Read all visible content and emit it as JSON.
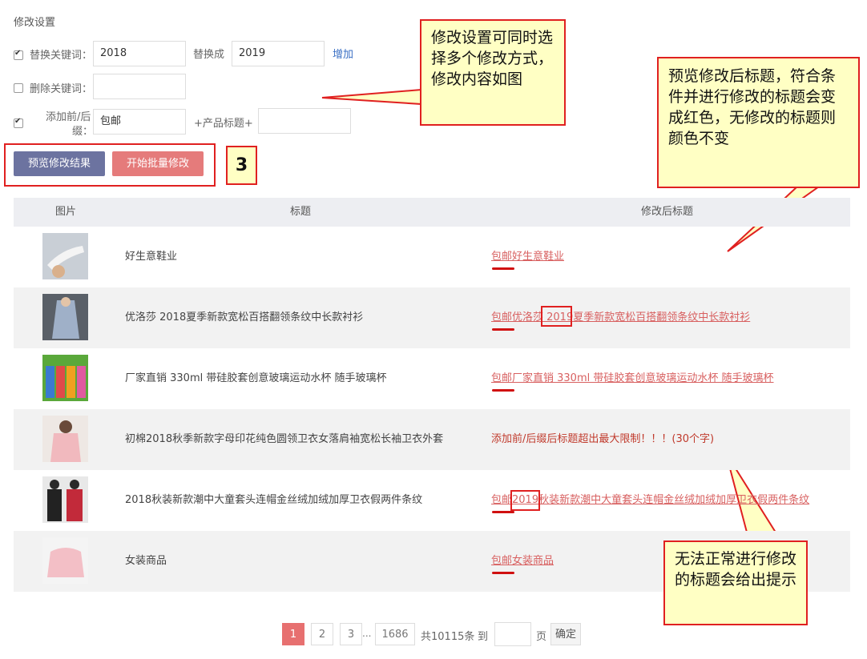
{
  "settings": {
    "title": "修改设置",
    "replace": {
      "label": "替换关键词：",
      "checked": true,
      "from": "2018",
      "to_label": "替换成",
      "to": "2019",
      "add_link": "增加"
    },
    "delete": {
      "label": "删除关键词：",
      "checked": false,
      "value": ""
    },
    "affix": {
      "label_line1": "添加前/后",
      "label_line2": "缀：",
      "checked": true,
      "prefix": "包邮",
      "mid_label": "+产品标题+",
      "suffix": ""
    }
  },
  "actions": {
    "preview_label": "预览修改结果",
    "start_label": "开始批量修改",
    "step_badge": "3"
  },
  "callouts": {
    "settings_note": "修改设置可同时选择多个修改方式，修改内容如图",
    "preview_note": "预览修改后标题，符合条件并进行修改的标题会变成红色，无修改的标题则颜色不变",
    "error_note": "无法正常进行修改的标题会给出提示"
  },
  "table": {
    "headers": {
      "image": "图片",
      "title": "标题",
      "new_title": "修改后标题"
    },
    "rows": [
      {
        "title": "好生意鞋业",
        "new_title": "包邮好生意鞋业",
        "type": "ok"
      },
      {
        "title": "优洛莎 2018夏季新款宽松百搭翻领条纹中长款衬衫",
        "new_title": "包邮优洛莎 2019夏季新款宽松百搭翻领条纹中长款衬衫",
        "type": "ok"
      },
      {
        "title": "厂家直销 330ml 带硅胶套创意玻璃运动水杯 随手玻璃杯",
        "new_title": "包邮厂家直销 330ml 带硅胶套创意玻璃运动水杯 随手玻璃杯",
        "type": "ok"
      },
      {
        "title": "初棉2018秋季新款字母印花纯色圆领卫衣女落肩袖宽松长袖卫衣外套",
        "new_title": "添加前/后缀后标题超出最大限制！！！(30个字)",
        "type": "warn"
      },
      {
        "title": "2018秋装新款潮中大童套头连帽金丝绒加绒加厚卫衣假两件条纹",
        "new_title": "包邮2019秋装新款潮中大童套头连帽金丝绒加绒加厚卫衣假两件条纹",
        "type": "ok"
      },
      {
        "title": "女装商品",
        "new_title": "包邮女装商品",
        "type": "ok"
      }
    ]
  },
  "pagination": {
    "pages": [
      "1",
      "2",
      "3"
    ],
    "ellipsis": "...",
    "last": "1686",
    "total": "共10115条",
    "goto": "到",
    "page_unit": "页",
    "confirm": "确定"
  }
}
